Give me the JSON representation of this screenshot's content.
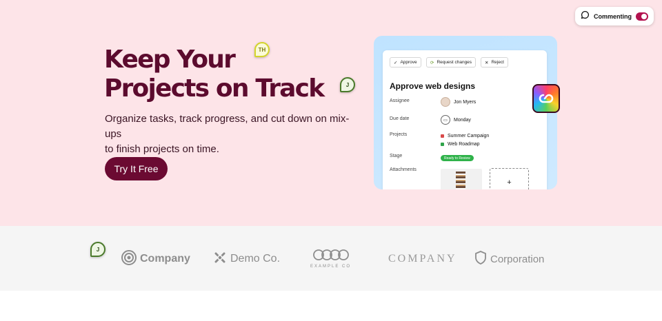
{
  "hero": {
    "title_line1": "Keep Your",
    "title_line2": "Projects on Track",
    "subtitle_line1": "Organize tasks, track progress, and cut down on mix-ups",
    "subtitle_line2": "to finish projects on time.",
    "cta_label": "Try It Free"
  },
  "comment_pins": {
    "th": "TH",
    "j_top": "J",
    "j_bottom": "J"
  },
  "commenting_toggle": {
    "label": "Commenting",
    "enabled": true
  },
  "mockup": {
    "toolbar": {
      "approve": "Approve",
      "request_changes": "Request changes",
      "reject": "Reject"
    },
    "title": "Approve web designs",
    "assignee_label": "Assignee",
    "assignee_value": "Jon Myers",
    "due_date_label": "Due date",
    "due_date_value": "Monday",
    "projects_label": "Projects",
    "projects": [
      {
        "name": "Summer Campaign",
        "color": "#d94a4a"
      },
      {
        "name": "Web Roadmap",
        "color": "#2fa34a"
      }
    ],
    "stage_label": "Stage",
    "stage_value": "Ready to Review",
    "attachments_label": "Attachments",
    "add_symbol": "+"
  },
  "logos": {
    "company1": "Company",
    "demo": "Demo Co.",
    "example": "EXAMPLE CO",
    "company2": "COMPANY",
    "corporation": "Corporation"
  },
  "colors": {
    "hero_bg": "#fde4e8",
    "brand": "#6b0a32",
    "title": "#5c0b2e",
    "stage_green": "#2fb24a"
  }
}
